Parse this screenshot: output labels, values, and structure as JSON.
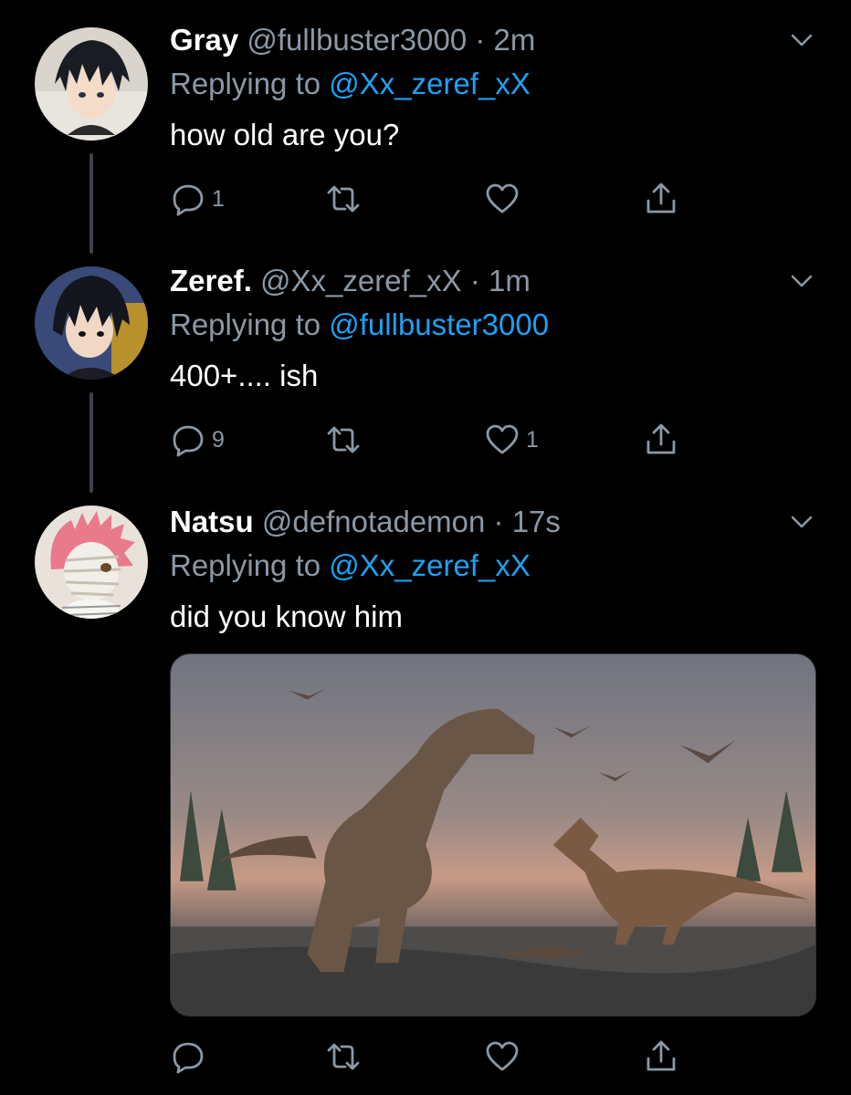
{
  "tweets": [
    {
      "name": "Gray",
      "handle": "@fullbuster3000",
      "time": "· 2m",
      "replying_prefix": "Replying to ",
      "replying_to": "@Xx_zeref_xX",
      "text": "how old are you?",
      "reply_count": "1",
      "retweet_count": "",
      "like_count": "",
      "avatar_icon": "avatar-gray-dark-hair"
    },
    {
      "name": "Zeref.",
      "handle": "@Xx_zeref_xX",
      "time": "· 1m",
      "replying_prefix": "Replying to ",
      "replying_to": "@fullbuster3000",
      "text": "400+.... ish",
      "reply_count": "9",
      "retweet_count": "",
      "like_count": "1",
      "avatar_icon": "avatar-zeref-dark-hair"
    },
    {
      "name": "Natsu",
      "handle": "@defnotademon",
      "time": "· 17s",
      "replying_prefix": "Replying to ",
      "replying_to": "@Xx_zeref_xX",
      "text": "did you know him",
      "reply_count": "",
      "retweet_count": "",
      "like_count": "",
      "avatar_icon": "avatar-natsu-pink-hair-bandaged",
      "media": "dinosaur-illustration"
    }
  ],
  "colors": {
    "background": "#000000",
    "text": "#ffffff",
    "secondary": "#8b98a5",
    "mention": "#1da1f2",
    "thread_line": "#3d4249"
  },
  "icons": [
    "reply-icon",
    "retweet-icon",
    "like-icon",
    "share-icon",
    "chevron-down-icon"
  ]
}
